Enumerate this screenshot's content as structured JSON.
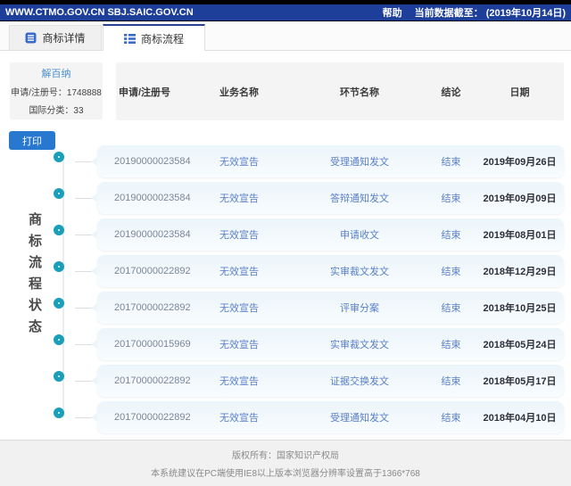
{
  "header": {
    "site": "WWW.CTMO.GOV.CN SBJ.SAIC.GOV.CN",
    "help_label": "帮助",
    "data_as_of": "当前数据截至： (2019年10月14日)"
  },
  "tabs": [
    {
      "label": "商标详情"
    },
    {
      "label": "商标流程"
    }
  ],
  "info_panel": {
    "trademark_name": "解百纳",
    "reg_no": "申请/注册号：1748888",
    "intl_class": "国际分类：33"
  },
  "print_label": "打印",
  "side_label": "商标流程状态",
  "table": {
    "columns": [
      "申请/注册号",
      "业务名称",
      "环节名称",
      "结论",
      "日期"
    ],
    "rows": [
      {
        "reg_no": "20190000023584",
        "business": "无效宣告",
        "step": "受理通知发文",
        "conclusion": "结束",
        "date": "2019年09月26日"
      },
      {
        "reg_no": "20190000023584",
        "business": "无效宣告",
        "step": "答辩通知发文",
        "conclusion": "结束",
        "date": "2019年09月09日"
      },
      {
        "reg_no": "20190000023584",
        "business": "无效宣告",
        "step": "申请收文",
        "conclusion": "结束",
        "date": "2019年08月01日"
      },
      {
        "reg_no": "20170000022892",
        "business": "无效宣告",
        "step": "实审裁文发文",
        "conclusion": "结束",
        "date": "2018年12月29日"
      },
      {
        "reg_no": "20170000022892",
        "business": "无效宣告",
        "step": "评审分案",
        "conclusion": "结束",
        "date": "2018年10月25日"
      },
      {
        "reg_no": "20170000015969",
        "business": "无效宣告",
        "step": "实审裁文发文",
        "conclusion": "结束",
        "date": "2018年05月24日"
      },
      {
        "reg_no": "20170000022892",
        "business": "无效宣告",
        "step": "证据交换发文",
        "conclusion": "结束",
        "date": "2018年05月17日"
      },
      {
        "reg_no": "20170000022892",
        "business": "无效宣告",
        "step": "受理通知发文",
        "conclusion": "结束",
        "date": "2018年04月10日"
      }
    ]
  },
  "footer": {
    "line1": "版权所有：国家知识产权局",
    "line2": "本系统建议在PC端使用IE8以上版本浏览器分辨率设置高于1366*768"
  },
  "colors": {
    "topbar_blue": "#1d3e99",
    "accent_blue": "#2878d0",
    "node_teal": "#1a9fba",
    "row_bg": "#ecf5fa",
    "link_blue": "#5b80c8"
  }
}
